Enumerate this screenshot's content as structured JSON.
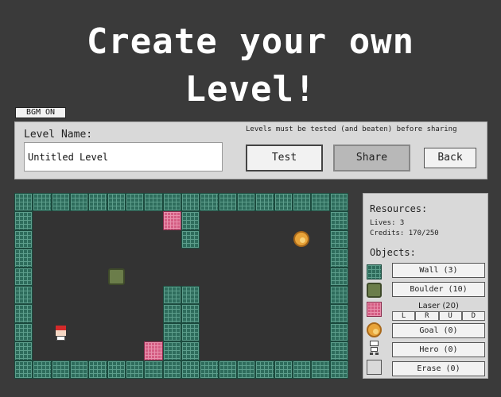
{
  "title": {
    "line1": "Create your own",
    "line2": "Level!"
  },
  "bgm_toggle": "BGM ON",
  "level": {
    "name_label": "Level Name:",
    "name_value": "Untitled Level",
    "note": "Levels must be tested (and beaten) before sharing"
  },
  "buttons": {
    "test": "Test",
    "share": "Share",
    "back": "Back"
  },
  "resources": {
    "title": "Resources:",
    "lives": "Lives: 3",
    "credits": "Credits: 170/250"
  },
  "objects": {
    "title": "Objects:",
    "wall": "Wall (3)",
    "boulder": "Boulder (10)",
    "laser": "Laser (20)",
    "laser_dirs": [
      "L",
      "R",
      "U",
      "D"
    ],
    "goal": "Goal (0)",
    "hero": "Hero (0)",
    "erase": "Erase (0)"
  },
  "colors": {
    "background": "#3a3a3a",
    "wall": "#2e6c5c",
    "laser": "#d45c82",
    "boulder": "#6b7d4a",
    "goal": "#e8a43a",
    "hero": "#d42a2a"
  },
  "board": {
    "cols": 18,
    "rows": 10,
    "walls": [
      [
        0,
        0
      ],
      [
        1,
        0
      ],
      [
        2,
        0
      ],
      [
        3,
        0
      ],
      [
        4,
        0
      ],
      [
        5,
        0
      ],
      [
        6,
        0
      ],
      [
        7,
        0
      ],
      [
        8,
        0
      ],
      [
        9,
        0
      ],
      [
        10,
        0
      ],
      [
        11,
        0
      ],
      [
        12,
        0
      ],
      [
        13,
        0
      ],
      [
        14,
        0
      ],
      [
        15,
        0
      ],
      [
        16,
        0
      ],
      [
        17,
        0
      ],
      [
        0,
        9
      ],
      [
        1,
        9
      ],
      [
        2,
        9
      ],
      [
        3,
        9
      ],
      [
        4,
        9
      ],
      [
        5,
        9
      ],
      [
        6,
        9
      ],
      [
        7,
        9
      ],
      [
        8,
        9
      ],
      [
        9,
        9
      ],
      [
        10,
        9
      ],
      [
        11,
        9
      ],
      [
        12,
        9
      ],
      [
        13,
        9
      ],
      [
        14,
        9
      ],
      [
        15,
        9
      ],
      [
        16,
        9
      ],
      [
        17,
        9
      ],
      [
        0,
        1
      ],
      [
        0,
        2
      ],
      [
        0,
        3
      ],
      [
        0,
        4
      ],
      [
        0,
        5
      ],
      [
        0,
        6
      ],
      [
        0,
        7
      ],
      [
        0,
        8
      ],
      [
        17,
        1
      ],
      [
        17,
        2
      ],
      [
        17,
        3
      ],
      [
        17,
        4
      ],
      [
        17,
        5
      ],
      [
        17,
        6
      ],
      [
        17,
        7
      ],
      [
        17,
        8
      ],
      [
        9,
        1
      ],
      [
        9,
        2
      ],
      [
        8,
        5
      ],
      [
        9,
        5
      ],
      [
        8,
        6
      ],
      [
        9,
        6
      ],
      [
        8,
        7
      ],
      [
        9,
        7
      ],
      [
        8,
        8
      ],
      [
        9,
        8
      ]
    ],
    "lasers": [
      [
        8,
        1
      ],
      [
        7,
        8
      ]
    ],
    "boulders": [
      [
        5,
        4
      ]
    ],
    "goals": [
      [
        15,
        2
      ]
    ],
    "heroes": [
      [
        2,
        7
      ]
    ]
  }
}
